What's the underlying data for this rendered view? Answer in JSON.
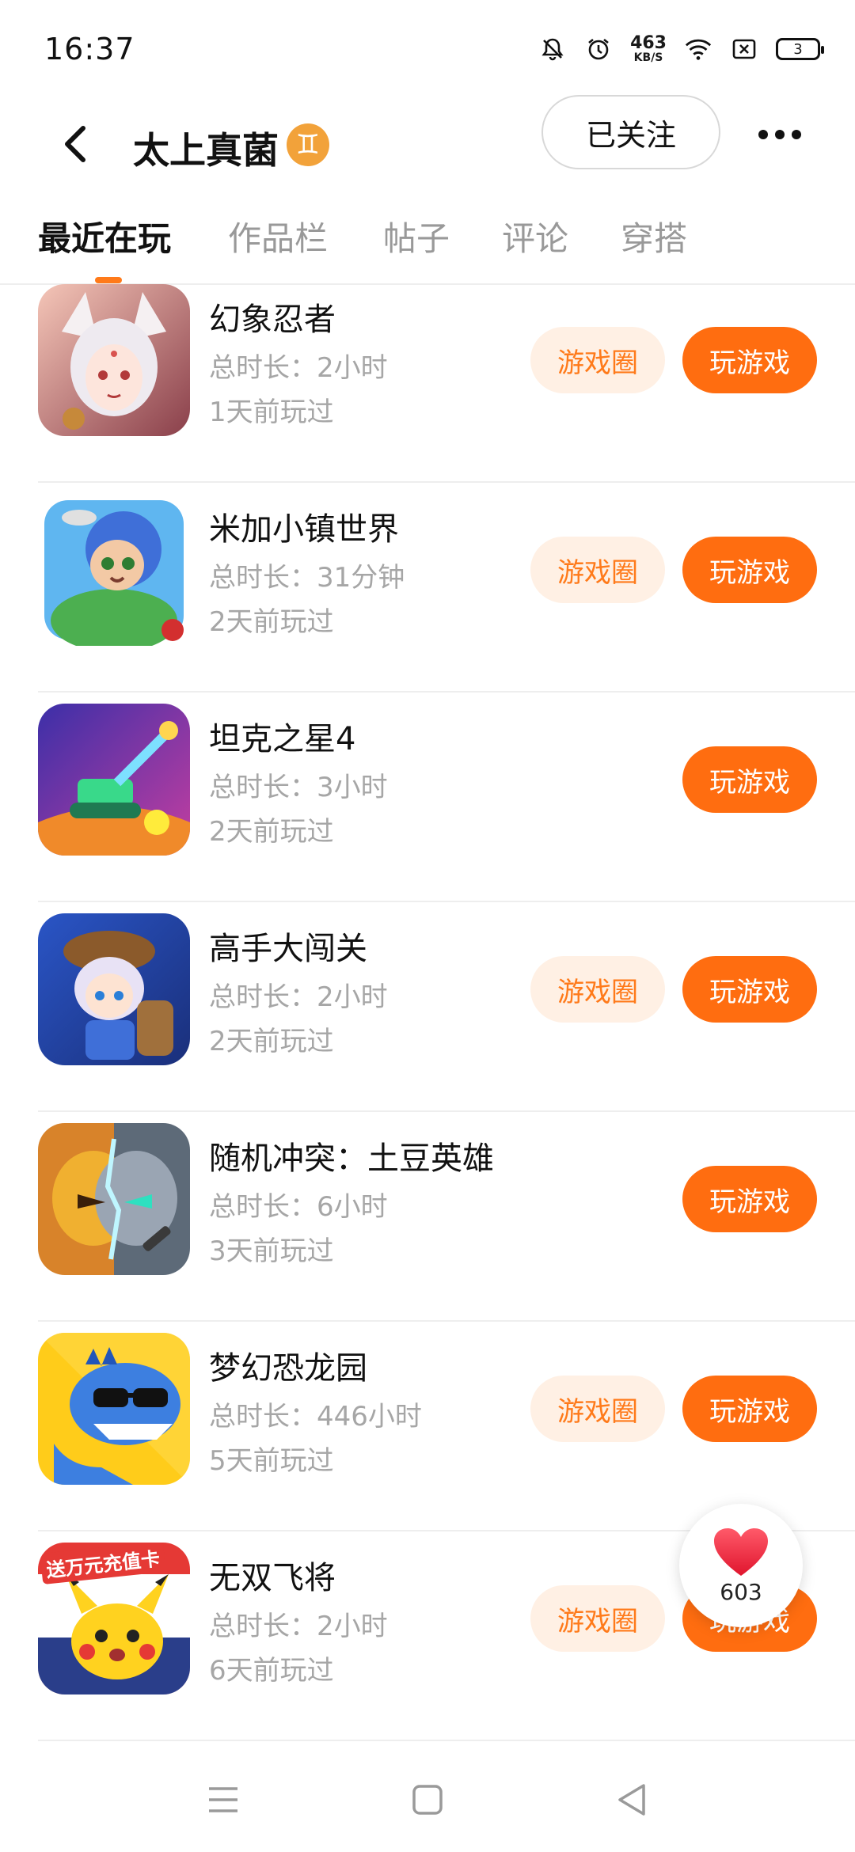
{
  "status_bar": {
    "time": "16:37",
    "net_speed_value": "463",
    "net_speed_unit": "KB/S",
    "battery": "3"
  },
  "header": {
    "user_name": "太上真菌",
    "zodiac_glyph": "♊",
    "follow_label": "已关注"
  },
  "tabs": [
    {
      "label": "最近在玩",
      "active": true
    },
    {
      "label": "作品栏",
      "active": false
    },
    {
      "label": "帖子",
      "active": false
    },
    {
      "label": "评论",
      "active": false
    },
    {
      "label": "穿搭",
      "active": false
    }
  ],
  "games": [
    {
      "title": "幻象忍者",
      "duration": "总时长：2小时",
      "last_played": "1天前玩过",
      "circle_label": "游戏圈",
      "play_label": "玩游戏",
      "has_circle": true,
      "icon": "ninja-girl-icon"
    },
    {
      "title": "米加小镇世界",
      "duration": "总时长：31分钟",
      "last_played": "2天前玩过",
      "circle_label": "游戏圈",
      "play_label": "玩游戏",
      "has_circle": true,
      "icon": "miga-town-icon"
    },
    {
      "title": "坦克之星4",
      "duration": "总时长：3小时",
      "last_played": "2天前玩过",
      "circle_label": "",
      "play_label": "玩游戏",
      "has_circle": false,
      "icon": "tank-icon"
    },
    {
      "title": "高手大闯关",
      "duration": "总时长：2小时",
      "last_played": "2天前玩过",
      "circle_label": "游戏圈",
      "play_label": "玩游戏",
      "has_circle": true,
      "icon": "adventurer-icon"
    },
    {
      "title": "随机冲突：土豆英雄",
      "duration": "总时长：6小时",
      "last_played": "3天前玩过",
      "circle_label": "",
      "play_label": "玩游戏",
      "has_circle": false,
      "icon": "potato-hero-icon"
    },
    {
      "title": "梦幻恐龙园",
      "duration": "总时长：446小时",
      "last_played": "5天前玩过",
      "circle_label": "游戏圈",
      "play_label": "玩游戏",
      "has_circle": true,
      "icon": "dinosaur-icon"
    },
    {
      "title": "无双飞将",
      "duration": "总时长：2小时",
      "last_played": "6天前玩过",
      "circle_label": "游戏圈",
      "play_label": "玩游戏",
      "has_circle": true,
      "icon": "pikachu-icon",
      "icon_banner": "送万元充值卡"
    }
  ],
  "like": {
    "count": "603"
  },
  "colors": {
    "accent": "#ff6d10",
    "accent_light": "#fff0e4",
    "secondary_text": "#a6a6a6"
  }
}
